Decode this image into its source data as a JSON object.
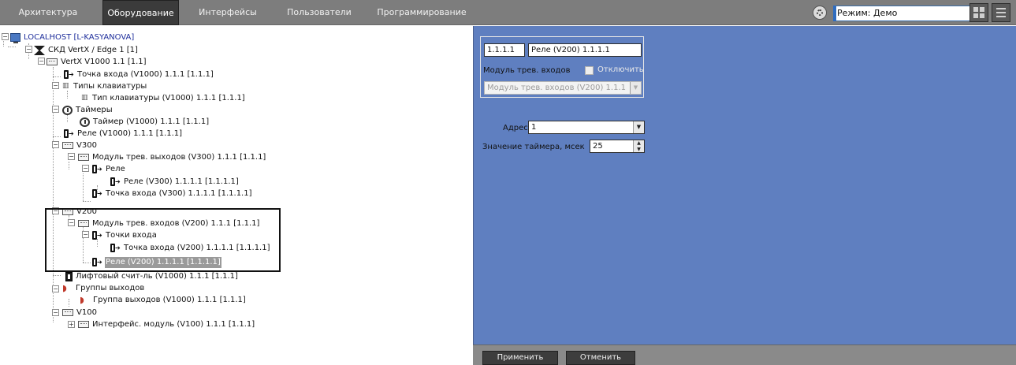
{
  "menu": {
    "tabs": [
      {
        "label": "Архитектура",
        "active": false
      },
      {
        "label": "Оборудование",
        "active": true
      },
      {
        "label": "Интерфейсы",
        "active": false
      },
      {
        "label": "Пользователи",
        "active": false
      },
      {
        "label": "Программирование",
        "active": false
      }
    ],
    "mode_label": "Режим: Демо"
  },
  "tree": {
    "nodes": [
      {
        "label": "LOCALHOST [L-KASYANOVA]",
        "icon": "computer-icon"
      },
      {
        "label": "СКД VertX / Edge 1 [1]",
        "icon": "skd-icon"
      },
      {
        "label": "VertX V1000 1.1 [1.1]",
        "icon": "board-icon"
      },
      {
        "label": "Точка входа (V1000) 1.1.1 [1.1.1]",
        "icon": "door-icon"
      },
      {
        "label": "Типы клавиатуры",
        "icon": "keypad-icon"
      },
      {
        "label": "Тип клавиатуры (V1000) 1.1.1 [1.1.1]",
        "icon": "keypad-icon"
      },
      {
        "label": "Таймеры",
        "icon": "timer-icon"
      },
      {
        "label": "Таймер (V1000) 1.1.1 [1.1.1]",
        "icon": "timer-icon"
      },
      {
        "label": "Реле (V1000) 1.1.1 [1.1.1]",
        "icon": "door-icon"
      },
      {
        "label": "V300",
        "icon": "board-icon"
      },
      {
        "label": "Модуль трев. выходов (V300) 1.1.1 [1.1.1]",
        "icon": "board-icon"
      },
      {
        "label": "Реле",
        "icon": "door-icon"
      },
      {
        "label": "Реле (V300) 1.1.1.1 [1.1.1.1]",
        "icon": "door-icon"
      },
      {
        "label": "Точка входа (V300) 1.1.1.1 [1.1.1.1]",
        "icon": "door-icon"
      },
      {
        "label": "V200",
        "icon": "board-icon"
      },
      {
        "label": "Модуль трев. входов (V200) 1.1.1 [1.1.1]",
        "icon": "board-icon"
      },
      {
        "label": "Точки входа",
        "icon": "door-icon"
      },
      {
        "label": "Точка входа (V200) 1.1.1.1 [1.1.1.1]",
        "icon": "door-icon"
      },
      {
        "label": "Реле (V200) 1.1.1.1 [1.1.1.1]",
        "icon": "door-icon"
      },
      {
        "label": "Лифтовый счит-ль (V1000) 1.1.1 [1.1.1]",
        "icon": "lift-icon"
      },
      {
        "label": "Группы выходов",
        "icon": "output-group-icon"
      },
      {
        "label": "Группа выходов (V1000) 1.1.1 [1.1.1]",
        "icon": "output-group-icon"
      },
      {
        "label": "V100",
        "icon": "board-icon"
      },
      {
        "label": "Интерфейс. модуль (V100) 1.1.1 [1.1.1]",
        "icon": "board-icon"
      }
    ]
  },
  "panel": {
    "id_value": "1.1.1.1",
    "name_value": "Реле (V200) 1.1.1.1",
    "parent_label": "Модуль трев. входов",
    "disable_label": "Отключить",
    "parent_select_value": "Модуль трев. входов (V200) 1.1.1",
    "address_label": "Адрес",
    "address_value": "1",
    "timer_label": "Значение таймера, мсек",
    "timer_value": "25"
  },
  "footer": {
    "apply_label": "Применить",
    "cancel_label": "Отменить"
  },
  "colors": {
    "panel_bg": "#5f7fc0",
    "menubar_bg": "#7d7d7d",
    "active_tab": "#3b3b3b"
  }
}
